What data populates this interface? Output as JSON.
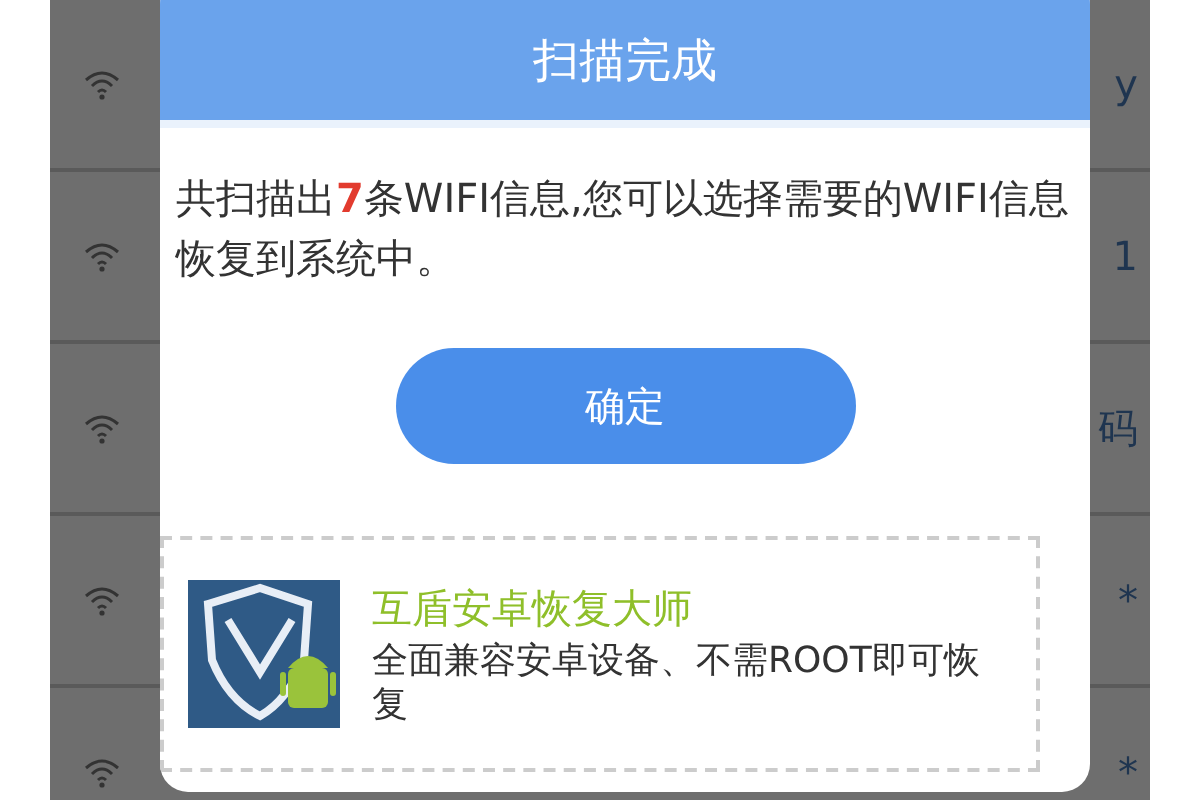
{
  "background_list": [
    {
      "trailing": "y"
    },
    {
      "trailing": "1"
    },
    {
      "trailing": "码"
    },
    {
      "trailing": "*"
    },
    {
      "trailing": "*"
    }
  ],
  "dialog": {
    "title": "扫描完成",
    "message_before": "共扫描出",
    "count": "7",
    "message_after": "条WIFI信息,您可以选择需要的WIFI信息恢复到系统中。",
    "button": "确定",
    "promo": {
      "title": "互盾安卓恢复大师",
      "description": "全面兼容安卓设备、不需ROOT即可恢复"
    }
  }
}
